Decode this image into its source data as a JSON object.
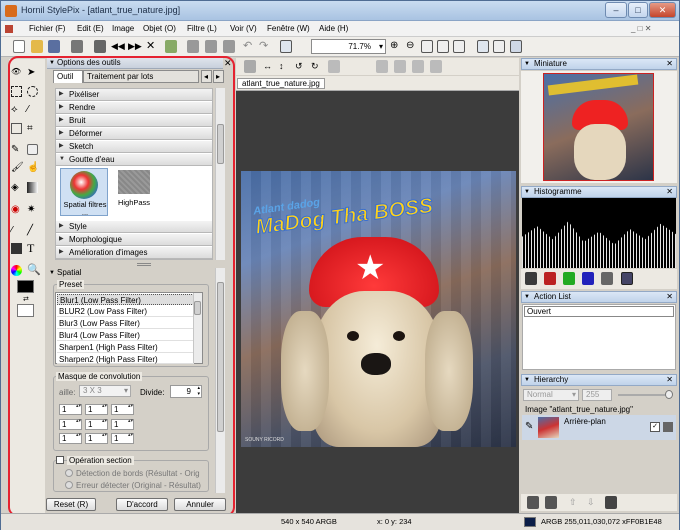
{
  "window": {
    "title": "Hornil StylePix - [atlant_true_nature.jpg]"
  },
  "menu": [
    "Fichier (F)",
    "Edit (E)",
    "Image",
    "Objet (O)",
    "Filtre (L)",
    "Voir (V)",
    "Fenêtre (W)",
    "Aide (H)"
  ],
  "toolbar": {
    "zoom": "71.7%"
  },
  "tool_options": {
    "title": "Options des outils",
    "tabs": [
      "Outil",
      "Traitement par lots"
    ],
    "categories": [
      "Pixéliser",
      "Rendre",
      "Bruit",
      "Déformer",
      "Sketch",
      "Goutte d'eau",
      "Style",
      "Morphologique",
      "Amélioration d'images"
    ],
    "thumbs": [
      {
        "label": "Spatial filtres\n..."
      },
      {
        "label": "HighPass"
      }
    ],
    "section": "Spatial",
    "preset_label": "Preset",
    "presets": [
      "Blur1 (Low Pass Filter)",
      "BLUR2 (Low Pass Filter)",
      "Blur3 (Low Pass Filter)",
      "Blur4 (Low Pass Filter)",
      "Sharpen1 (High Pass Filter)",
      "Sharpen2 (High Pass Filter)"
    ],
    "matrix_label": "Masque de convolution",
    "size_label": "aille:",
    "size_value": "3 X 3",
    "divide_label": "Divide:",
    "divide_value": "9",
    "matrix": [
      [
        "1",
        "1",
        "1"
      ],
      [
        "1",
        "1",
        "1"
      ],
      [
        "1",
        "1",
        "1"
      ]
    ],
    "operation_label": "Opération section",
    "radio1": "Détection de bords (Résultat - Orig",
    "radio2": "Erreur détecter (Original - Résultat)",
    "buttons": [
      "Reset (R)",
      "D'accord",
      "Annuler"
    ]
  },
  "document": {
    "tab": "atlant_true_nature.jpg",
    "image_text_top": "Atlant dadog",
    "image_text_main": "MaDog Tha BOSS",
    "credit": "SOUNY RICORD"
  },
  "right_panels": {
    "miniature": "Miniature",
    "histogram": "Histogramme",
    "action_list": "Action List",
    "action_item": "Ouvert",
    "hierarchy": "Hierarchy",
    "blend": "Normal",
    "opacity": "255",
    "image_name": "Image \"atlant_true_nature.jpg\"",
    "layer": "Arrière-plan"
  },
  "status": {
    "size": "540 x 540 ARGB",
    "coords": "x:   0 y: 234",
    "color": "ARGB 255,011,030,072 xFF0B1E48"
  },
  "colors": {
    "highlight": "#e52230",
    "title": "#c9dcf0"
  }
}
